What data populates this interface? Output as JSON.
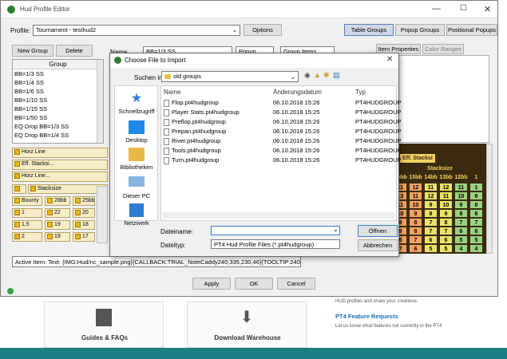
{
  "editor": {
    "title": "Hud Profile Editor",
    "profile_label": "Profile:",
    "profile_value": "Tournament - testhud2",
    "options_label": "Options",
    "tabs": [
      "Table Groups",
      "Popup Groups",
      "Positional Popups"
    ],
    "new_group_label": "New Group",
    "delete_label": "Delete",
    "group_header": "Group",
    "groups": [
      "BB=1/3 SS",
      "BB=1/4 SS",
      "BB=1/6 SS",
      "BB=1/10 SS",
      "BB=1/15 SS",
      "BB=1/50 SS",
      "EQ Drop BB=1/3 SS",
      "EQ Drop BB=1/4 SS"
    ],
    "name_label": "Name",
    "name_value": "BB=1/3 SS",
    "popup_label": "Popup",
    "group_items_label": "Group Items",
    "item_tabs": [
      "Item Properties",
      "Color Ranges"
    ],
    "stat_lines": [
      "Horz Line",
      "Eff. Stacksi...",
      "Horz Line..."
    ],
    "grid_labels": [
      "Stacksize",
      "Bounty",
      "28bb",
      "25bb",
      "1",
      "22",
      "20",
      "1,5",
      "19",
      "18",
      "2",
      "19",
      "17"
    ],
    "hud_title": "Eff. Stacksi",
    "hud_sub": "Stacksize",
    "hud_cols": [
      "16bb",
      "15bb",
      "14bb",
      "13bb",
      "12bb",
      "1"
    ],
    "hud_rows": [
      [
        "11",
        "12",
        "11",
        "12",
        "11",
        "1"
      ],
      [
        "13",
        "11",
        "12",
        "11",
        "10",
        "9"
      ],
      [
        "11",
        "10",
        "9",
        "10",
        "9",
        "8"
      ],
      [
        "10",
        "9",
        "8",
        "9",
        "8",
        "8"
      ],
      [
        "9",
        "8",
        "7",
        "8",
        "7",
        "7"
      ],
      [
        "9",
        "8",
        "7",
        "7",
        "6",
        "6"
      ],
      [
        "8",
        "7",
        "6",
        "6",
        "5",
        "5"
      ],
      [
        "7",
        "6",
        "5",
        "5",
        "4",
        "4"
      ]
    ],
    "active_item": "Active Item: Text: {IMG:Hud/nc_sample.png}{CALLBACK:TRIAL_NoteCaddy240,335,230,46}{TOOLTIP:240,335,23",
    "apply_label": "Apply",
    "ok_label": "OK",
    "cancel_label": "Cancel"
  },
  "dialog": {
    "title": "Choose File to Import",
    "search_in_label": "Suchen in:",
    "folder": "old groups",
    "col_name": "Name",
    "col_date": "Änderungsdatum",
    "col_type": "Typ",
    "files": [
      {
        "name": "Flop.pt4hudgroup",
        "date": "06.10.2018 15:26",
        "type": "PT4HUDGROUP"
      },
      {
        "name": "Player Stats.pt4hudgroup",
        "date": "06.10.2018 15:25",
        "type": "PT4HUDGROUP"
      },
      {
        "name": "Preflop.pt4hudgroup",
        "date": "06.10.2018 15:26",
        "type": "PT4HUDGROUP"
      },
      {
        "name": "Prepan.pt4hudgroup",
        "date": "06.10.2018 15:26",
        "type": "PT4HUDGROUP"
      },
      {
        "name": "River.pt4hudgroup",
        "date": "06.10.2018 15:26",
        "type": "PT4HUDGROUP"
      },
      {
        "name": "Tools.pt4hudgroup",
        "date": "06.10.2018 15:26",
        "type": "PT4HUDGROUP"
      },
      {
        "name": "Turn.pt4hudgroup",
        "date": "06.10.2018 15:26",
        "type": "PT4HUDGROUP"
      }
    ],
    "nav": [
      "Schnellzugriff",
      "Desktop",
      "Bibliotheken",
      "Dieser PC",
      "Netzwerk"
    ],
    "filename_label": "Dateiname:",
    "filename_value": "",
    "filetype_label": "Dateityp:",
    "filetype_value": "PT4 Hud Profile Files (*.pt4hudgroup)",
    "open_label": "Öffnen",
    "cancel_label": "Abbrechen"
  },
  "web": {
    "card1": "Guides & FAQs",
    "card2": "Download Warehouse",
    "side_text1": "HUD profiles and share your creations.",
    "feature_title": "PT4 Feature Requests",
    "side_text2": "Let us know what features not currently in the PT4"
  },
  "colors": {
    "hud_bg": "#3a2a10",
    "hud_gold": "#f2d060",
    "orange": "#f4a261",
    "yellow": "#e9e36a",
    "green": "#9bd17e",
    "teal_bar": "#1a7e86"
  }
}
